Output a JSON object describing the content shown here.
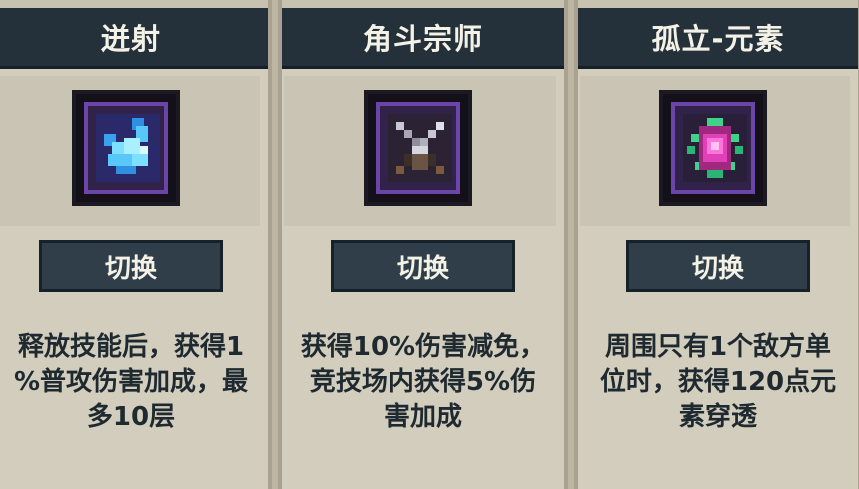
{
  "cards": [
    {
      "title": "迸射",
      "icon": "ice-shard-icon",
      "button": "切换",
      "desc_lines": [
        "释放技能后，获得1",
        "%普攻伤害加成，最",
        "多10层"
      ]
    },
    {
      "title": "角斗宗师",
      "icon": "crossed-swords-icon",
      "button": "切换",
      "desc_lines": [
        "获得10%伤害减免，",
        "竞技场内获得5%伤",
        "害加成"
      ]
    },
    {
      "title": "孤立-元素",
      "icon": "element-gem-icon",
      "button": "切换",
      "desc_lines": [
        "周围只有1个敌方单",
        "位时，获得120点元",
        "素穿透"
      ]
    }
  ],
  "colors": {
    "header_bg": "#24313a",
    "button_bg": "#2f3e48",
    "card_bg": "#d2cdbd",
    "icon_border": "#6b45a8"
  }
}
